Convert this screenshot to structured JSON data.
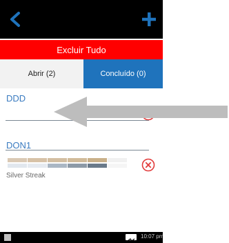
{
  "topbar": {
    "back_icon": "chevron-left-icon",
    "add_icon": "plus-icon",
    "accent_color": "#1f73bc"
  },
  "delete_all": {
    "label": "Excluir Tudo",
    "color": "#ff0000"
  },
  "tabs": [
    {
      "label": "Abrir (2)",
      "selected": true
    },
    {
      "label": "Concluído (0)",
      "selected": false
    }
  ],
  "items": [
    {
      "title": "DDD",
      "delete_icon": "remove-circle-icon"
    },
    {
      "title": "DON1",
      "delete_icon": "remove-circle-icon",
      "shade_name": "Silver Streak",
      "swatches": [
        [
          "#dac9b4",
          "#d7c2a7",
          "#d3bea1",
          "#d1bb9a",
          "#c9b089",
          "#f1f1f1"
        ],
        [
          "#e1e7ee",
          "#e5eaf0",
          "#aab7c4",
          "#8d9aa7",
          "#6a7a8a",
          "#f5f5f5"
        ]
      ]
    }
  ],
  "statusbar": {
    "time": "10:07 pm"
  },
  "overlay": {
    "icon": "arrow-left-icon",
    "color": "#bdbdbd"
  }
}
